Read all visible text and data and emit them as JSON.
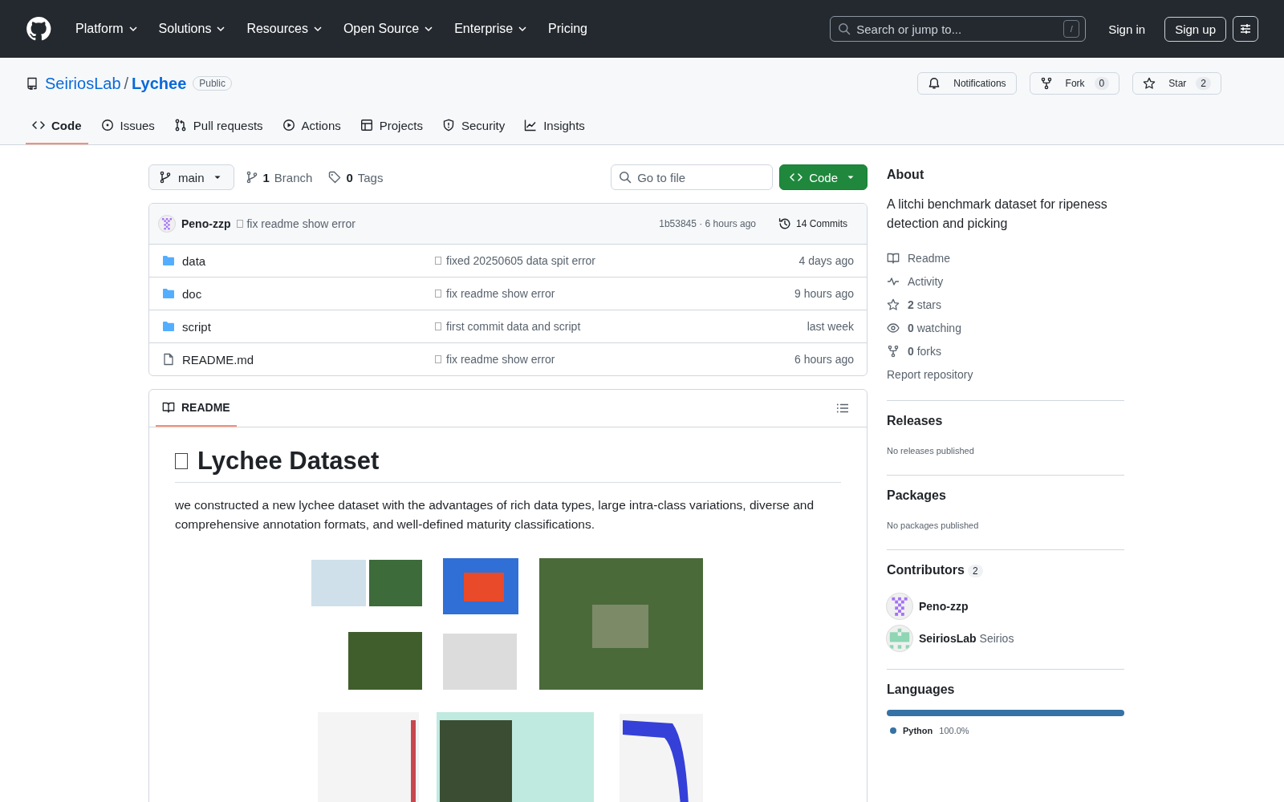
{
  "header": {
    "nav": [
      {
        "label": "Platform",
        "kind": "menu"
      },
      {
        "label": "Solutions",
        "kind": "menu"
      },
      {
        "label": "Resources",
        "kind": "menu"
      },
      {
        "label": "Open Source",
        "kind": "menu"
      },
      {
        "label": "Enterprise",
        "kind": "menu"
      },
      {
        "label": "Pricing",
        "kind": "link"
      }
    ],
    "search": {
      "placeholder": "Search or jump to...",
      "shortcut": "/"
    },
    "sign_in": "Sign in",
    "sign_up": "Sign up"
  },
  "repo": {
    "owner": "SeiriosLab",
    "separator": "/",
    "name": "Lychee",
    "visibility": "Public",
    "actions": [
      {
        "kind": "notifications",
        "label": "Notifications"
      },
      {
        "kind": "fork",
        "label": "Fork",
        "count": "0"
      },
      {
        "kind": "star",
        "label": "Star",
        "count": "2"
      }
    ]
  },
  "tabs": [
    {
      "kind": "code",
      "label": "Code",
      "selected": true
    },
    {
      "kind": "issues",
      "label": "Issues",
      "selected": false
    },
    {
      "kind": "pulls",
      "label": "Pull requests",
      "selected": false
    },
    {
      "kind": "actions",
      "label": "Actions",
      "selected": false
    },
    {
      "kind": "projects",
      "label": "Projects",
      "selected": false
    },
    {
      "kind": "security",
      "label": "Security",
      "selected": false
    },
    {
      "kind": "insights",
      "label": "Insights",
      "selected": false
    }
  ],
  "toolbar": {
    "branch": "main",
    "branch_count": "1",
    "branch_label": "Branch",
    "tag_count": "0",
    "tag_label": "Tags",
    "go_to_file": {
      "placeholder": "Go to file"
    },
    "code_button": "Code"
  },
  "latest_commit": {
    "author": "Peno-zzp",
    "message": "fix readme show error",
    "meta": "1b53845 · 6 hours ago",
    "commits": "14 Commits"
  },
  "files": [
    {
      "kind": "folder",
      "name": "data",
      "message": "fixed 20250605 data spit error",
      "age": "4 days ago"
    },
    {
      "kind": "folder",
      "name": "doc",
      "message": "fix readme show error",
      "age": "9 hours ago"
    },
    {
      "kind": "folder",
      "name": "script",
      "message": "first commit data and script",
      "age": "last week"
    },
    {
      "kind": "file",
      "name": "README.md",
      "message": "fix readme show error",
      "age": "6 hours ago"
    }
  ],
  "readme": {
    "tab": "README",
    "title": "Lychee Dataset",
    "paragraph": "we constructed a new lychee dataset with the advantages of rich data types, large intra-class variations, diverse and comprehensive annotation formats, and well-defined maturity classifications."
  },
  "sidebar": {
    "about": {
      "title": "About",
      "description": "A litchi benchmark dataset for ripeness detection and picking",
      "links": [
        {
          "kind": "readme",
          "label": "Readme"
        },
        {
          "kind": "activity",
          "label": "Activity"
        },
        {
          "kind": "star",
          "count": "2",
          "label": "stars"
        },
        {
          "kind": "watch",
          "count": "0",
          "label": "watching"
        },
        {
          "kind": "fork",
          "count": "0",
          "label": "forks"
        }
      ],
      "report": "Report repository"
    },
    "releases": {
      "title": "Releases",
      "note": "No releases published"
    },
    "packages": {
      "title": "Packages",
      "note": "No packages published"
    },
    "contributors": {
      "title": "Contributors",
      "count": "2",
      "people": [
        {
          "login": "Peno-zzp",
          "color": "#a371f7"
        },
        {
          "login": "SeiriosLab",
          "name": "Seirios",
          "color": "#8ed6b4"
        }
      ]
    },
    "languages": {
      "title": "Languages",
      "items": [
        {
          "name": "Python",
          "percent": "100.0%",
          "color": "#3572a5",
          "level": 1
        }
      ]
    }
  }
}
